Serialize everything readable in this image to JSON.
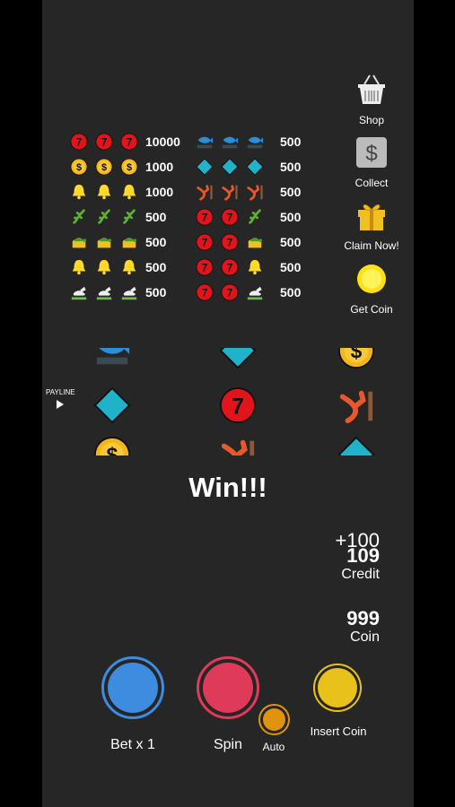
{
  "paytable": {
    "left": [
      {
        "value": "10000",
        "symbol": "seven-icon"
      },
      {
        "value": "1000",
        "symbol": "dollar-coin-icon"
      },
      {
        "value": "1000",
        "symbol": "bell-icon"
      },
      {
        "value": "500",
        "symbol": "lizard-icon"
      },
      {
        "value": "500",
        "symbol": "turtle-icon"
      },
      {
        "value": "500",
        "symbol": "bell-icon"
      },
      {
        "value": "500",
        "symbol": "rabbit-icon"
      }
    ],
    "right": [
      {
        "value": "500",
        "symbols": [
          "fish-icon",
          "fish-icon",
          "fish-icon"
        ]
      },
      {
        "value": "500",
        "symbols": [
          "diamond-icon",
          "diamond-icon",
          "diamond-icon"
        ]
      },
      {
        "value": "500",
        "symbols": [
          "bird-icon",
          "bird-icon",
          "bird-icon"
        ]
      },
      {
        "value": "500",
        "symbols": [
          "seven-icon",
          "seven-icon",
          "lizard-icon"
        ]
      },
      {
        "value": "500",
        "symbols": [
          "seven-icon",
          "seven-icon",
          "turtle-icon"
        ]
      },
      {
        "value": "500",
        "symbols": [
          "seven-icon",
          "seven-icon",
          "bell-icon"
        ]
      },
      {
        "value": "500",
        "symbols": [
          "seven-icon",
          "seven-icon",
          "rabbit-icon"
        ]
      }
    ]
  },
  "side_menu": {
    "shop": "Shop",
    "collect": "Collect",
    "claim": "Claim Now!",
    "get_coin": "Get Coin"
  },
  "reels": {
    "payline_label": "PAYLINE",
    "columns": [
      [
        "fish-icon",
        "diamond-icon",
        "dollar-coin-icon"
      ],
      [
        "diamond-icon",
        "seven-icon",
        "bird-icon"
      ],
      [
        "dollar-coin-icon",
        "bird-icon",
        "diamond-icon"
      ]
    ]
  },
  "win_text": "Win!!!",
  "credit": {
    "delta": "+100",
    "value": "109",
    "label": "Credit"
  },
  "coin": {
    "value": "999",
    "label": "Coin"
  },
  "controls": {
    "bet": "Bet x 1",
    "spin": "Spin",
    "auto": "Auto",
    "insert": "Insert Coin"
  },
  "colors": {
    "background": "#262626",
    "bet_button": "#3d8ce0",
    "spin_button": "#e03a5a",
    "auto_button": "#e0930f",
    "insert_button": "#e8c11a"
  }
}
